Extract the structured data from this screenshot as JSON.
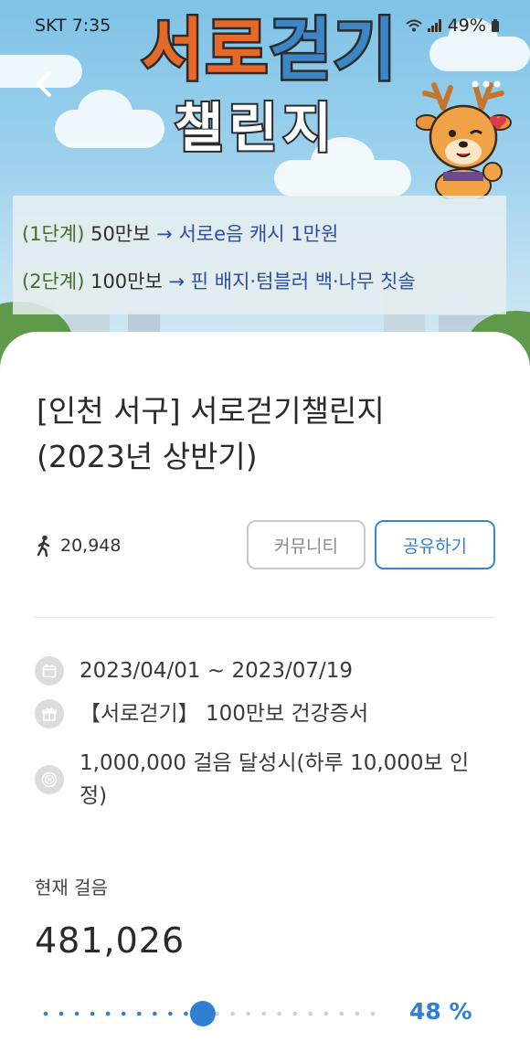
{
  "status_bar": {
    "left": "SKT  7:35",
    "battery": "49%"
  },
  "banner": {
    "title_line1_part1": "서로",
    "title_line1_part2": "걷기",
    "title_line2": "챌린지",
    "steps": [
      {
        "level": "(1단계)",
        "goal": "50만보",
        "arrow": "→",
        "reward": "서로e음 캐시 1만원"
      },
      {
        "level": "(2단계)",
        "goal": "100만보",
        "arrow": "→",
        "reward": "핀 배지·텀블러 백·나무 칫솔"
      }
    ]
  },
  "event": {
    "title_line1": "[인천 서구] 서로걷기챌린지",
    "title_line2": "(2023년 상반기)",
    "participants": "20,948",
    "community_label": "커뮤니티",
    "share_label": "공유하기",
    "period": "2023/04/01 ~ 2023/07/19",
    "reward": "【서로걷기】 100만보 건강증서",
    "goal": "1,000,000 걸음 달성시(하루 10,000보 인정)"
  },
  "progress": {
    "label": "현재 걸음",
    "steps": "481,026",
    "percent_text": "48 %",
    "fraction": 0.48
  },
  "colors": {
    "accent": "#2f7fd3",
    "title_orange": "#e6692a",
    "title_blue": "#3d86c6",
    "reward_text": "#2f4e9e",
    "level_text": "#4a6b22"
  },
  "icons": {
    "back": "back-arrow-icon",
    "more": "more-dots-icon",
    "walk": "walking-person-icon",
    "calendar": "calendar-icon",
    "gift": "gift-icon",
    "target": "target-icon"
  }
}
